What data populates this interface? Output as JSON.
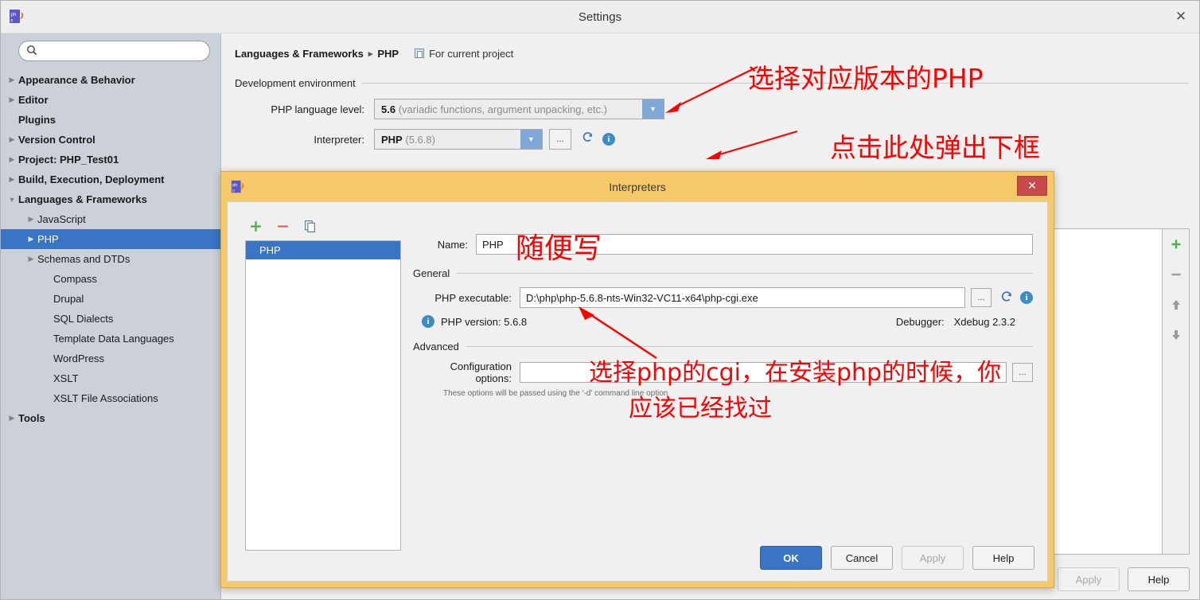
{
  "settings_window": {
    "title": "Settings",
    "app_icon": "phpstorm-logo-icon",
    "close_icon": "close-icon"
  },
  "search": {
    "placeholder": "",
    "value": "",
    "icon": "search-icon"
  },
  "sidebar": {
    "items": [
      {
        "label": "Appearance & Behavior",
        "indent": 1,
        "twisty": "collapsed",
        "bold": true,
        "selected": false
      },
      {
        "label": "Editor",
        "indent": 1,
        "twisty": "collapsed",
        "bold": true,
        "selected": false
      },
      {
        "label": "Plugins",
        "indent": 1,
        "twisty": "none",
        "bold": true,
        "selected": false
      },
      {
        "label": "Version Control",
        "indent": 1,
        "twisty": "collapsed",
        "bold": true,
        "selected": false
      },
      {
        "label": "Project: PHP_Test01",
        "indent": 1,
        "twisty": "collapsed",
        "bold": true,
        "selected": false
      },
      {
        "label": "Build, Execution, Deployment",
        "indent": 1,
        "twisty": "collapsed",
        "bold": true,
        "selected": false
      },
      {
        "label": "Languages & Frameworks",
        "indent": 1,
        "twisty": "expanded",
        "bold": true,
        "selected": false
      },
      {
        "label": "JavaScript",
        "indent": 2,
        "twisty": "collapsed",
        "bold": false,
        "selected": false
      },
      {
        "label": "PHP",
        "indent": 2,
        "twisty": "collapsed",
        "bold": false,
        "selected": true
      },
      {
        "label": "Schemas and DTDs",
        "indent": 2,
        "twisty": "collapsed",
        "bold": false,
        "selected": false
      },
      {
        "label": "Compass",
        "indent": 3,
        "twisty": "none",
        "bold": false,
        "selected": false
      },
      {
        "label": "Drupal",
        "indent": 3,
        "twisty": "none",
        "bold": false,
        "selected": false
      },
      {
        "label": "SQL Dialects",
        "indent": 3,
        "twisty": "none",
        "bold": false,
        "selected": false
      },
      {
        "label": "Template Data Languages",
        "indent": 3,
        "twisty": "none",
        "bold": false,
        "selected": false
      },
      {
        "label": "WordPress",
        "indent": 3,
        "twisty": "none",
        "bold": false,
        "selected": false
      },
      {
        "label": "XSLT",
        "indent": 3,
        "twisty": "none",
        "bold": false,
        "selected": false
      },
      {
        "label": "XSLT File Associations",
        "indent": 3,
        "twisty": "none",
        "bold": false,
        "selected": false
      },
      {
        "label": "Tools",
        "indent": 1,
        "twisty": "collapsed",
        "bold": true,
        "selected": false
      }
    ]
  },
  "main": {
    "breadcrumb_root": "Languages & Frameworks",
    "breadcrumb_sep": "▸",
    "breadcrumb_leaf": "PHP",
    "scope_label": "For current project",
    "scope_icon": "project-scope-icon",
    "section_dev_env": "Development environment",
    "php_level_label": "PHP language level:",
    "php_level_value": "5.6",
    "php_level_desc": "(variadic functions, argument unpacking, etc.)",
    "interpreter_label": "Interpreter:",
    "interpreter_value": "PHP",
    "interpreter_desc": "(5.6.8)",
    "browse_btn_label": "...",
    "refresh_icon": "refresh-icon",
    "info_icon": "info-icon",
    "dropdown_icon": "chevron-down-icon",
    "toolbar_icons": [
      "add-icon",
      "remove-icon",
      "move-up-icon",
      "move-down-icon"
    ],
    "footer_buttons": [
      {
        "label": "Apply",
        "state": "disabled"
      },
      {
        "label": "Help",
        "state": "normal"
      }
    ]
  },
  "dialog": {
    "title": "Interpreters",
    "app_icon": "phpstorm-logo-icon",
    "close_icon": "close-icon",
    "toolbar": [
      {
        "icon": "add-icon",
        "label": "+"
      },
      {
        "icon": "remove-icon",
        "label": "−"
      },
      {
        "icon": "copy-icon",
        "label": "copy"
      }
    ],
    "list_items": [
      {
        "label": "PHP",
        "selected": true
      }
    ],
    "name_label": "Name:",
    "name_value": "PHP",
    "section_general": "General",
    "executable_label": "PHP executable:",
    "executable_value": "D:\\php\\php-5.6.8-nts-Win32-VC11-x64\\php-cgi.exe",
    "browse_btn_label": "...",
    "refresh_icon": "refresh-icon",
    "info_icon": "info-icon",
    "version_icon": "info-icon",
    "version_text": "PHP version: 5.6.8",
    "debugger_label": "Debugger:",
    "debugger_value": "Xdebug 2.3.2",
    "section_advanced": "Advanced",
    "config_label": "Configuration options:",
    "config_value": "",
    "config_hint": "These options will be passed using the '-d' command line option",
    "buttons": [
      {
        "label": "OK",
        "state": "primary"
      },
      {
        "label": "Cancel",
        "state": "normal"
      },
      {
        "label": "Apply",
        "state": "disabled"
      },
      {
        "label": "Help",
        "state": "normal"
      }
    ]
  },
  "annotations": {
    "note_php_version": "选择对应版本的PHP",
    "note_click_here": "点击此处弹出下框",
    "note_write_anything": "随便写",
    "note_cgi_line1": "选择php的cgi，在安装php的时候，你",
    "note_cgi_line2": "应该已经找过",
    "color": "#ff0000"
  }
}
